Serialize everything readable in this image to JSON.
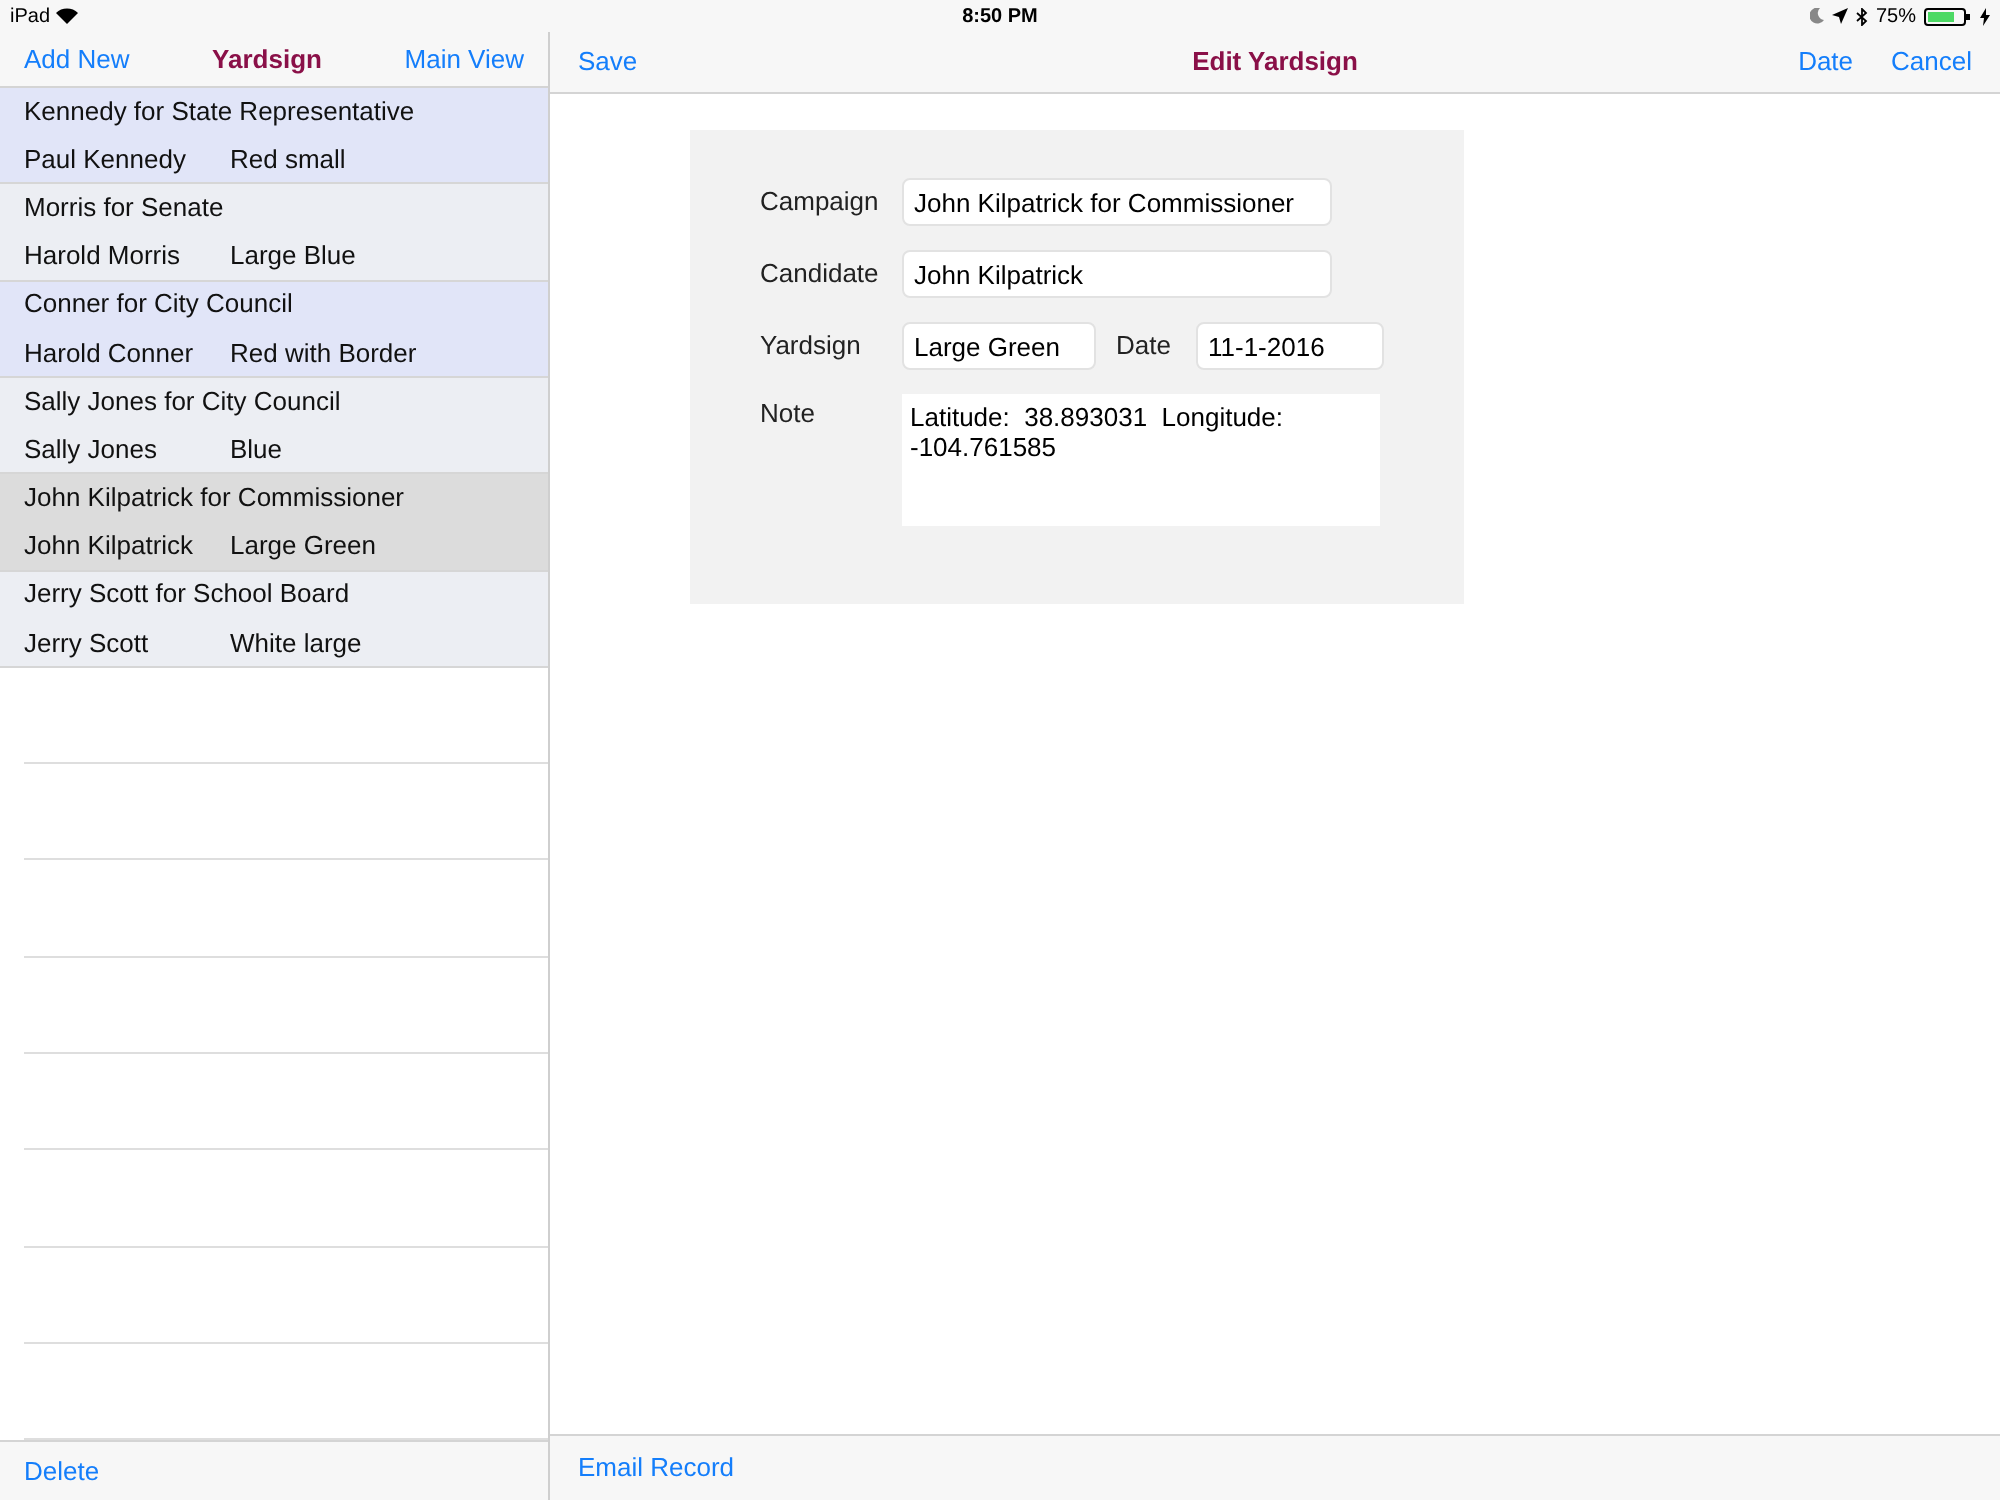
{
  "status_bar": {
    "device": "iPad",
    "time": "8:50 PM",
    "battery": "75%"
  },
  "list_nav": {
    "left": "Add New",
    "title": "Yardsign",
    "right": "Main View"
  },
  "detail_nav": {
    "left": "Save",
    "title": "Edit Yardsign",
    "date": "Date",
    "cancel": "Cancel"
  },
  "records": [
    {
      "campaign": "Kennedy for State Representative",
      "candidate": "Paul Kennedy",
      "yardsign": "Red small",
      "selected": false
    },
    {
      "campaign": "Morris for Senate",
      "candidate": "Harold Morris",
      "yardsign": "Large Blue",
      "selected": false
    },
    {
      "campaign": "Conner for City Council",
      "candidate": "Harold Conner",
      "yardsign": "Red with Border",
      "selected": false
    },
    {
      "campaign": "Sally Jones for City Council",
      "candidate": "Sally Jones",
      "yardsign": "Blue",
      "selected": false
    },
    {
      "campaign": "John Kilpatrick for Commissioner",
      "candidate": "John Kilpatrick",
      "yardsign": "Large Green",
      "selected": true
    },
    {
      "campaign": "Jerry Scott for School Board",
      "candidate": "Jerry Scott",
      "yardsign": "White large",
      "selected": false
    }
  ],
  "form": {
    "campaign_label": "Campaign",
    "campaign": "John Kilpatrick for Commissioner",
    "candidate_label": "Candidate",
    "candidate": "John Kilpatrick",
    "yardsign_label": "Yardsign",
    "yardsign": "Large Green",
    "date_label": "Date",
    "date": "11-1-2016",
    "note_label": "Note",
    "note": "Latitude:  38.893031  Longitude: -104.761585"
  },
  "list_toolbar": {
    "button": "Delete"
  },
  "detail_toolbar": {
    "button": "Email Record"
  }
}
